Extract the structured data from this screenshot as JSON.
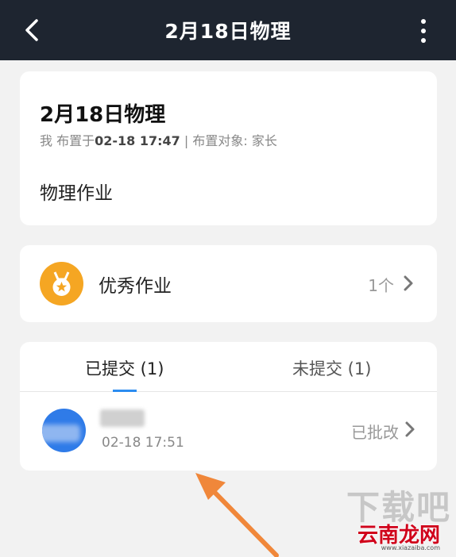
{
  "header": {
    "title": "2月18日物理"
  },
  "homework": {
    "title": "2月18日物理",
    "meta": {
      "assigner": "我",
      "assigned_prefix": "布置于",
      "assigned_time": "02-18 17:47",
      "separator": "|",
      "target_label": "布置对象:",
      "target": "家长"
    },
    "content": "物理作业"
  },
  "excellent": {
    "label": "优秀作业",
    "count": "1个",
    "icon": "medal-icon",
    "color": "#f5a623"
  },
  "submissions": {
    "tabs": [
      {
        "label": "已提交 (1)",
        "active": true
      },
      {
        "label": "未提交 (1)",
        "active": false
      }
    ],
    "accent": "#2c8cf0",
    "items": [
      {
        "time": "02-18 17:51",
        "status": "已批改"
      }
    ]
  },
  "watermark": {
    "top": "下载吧",
    "brand": "云南龙网",
    "url": "www.xiazaiba.com"
  }
}
